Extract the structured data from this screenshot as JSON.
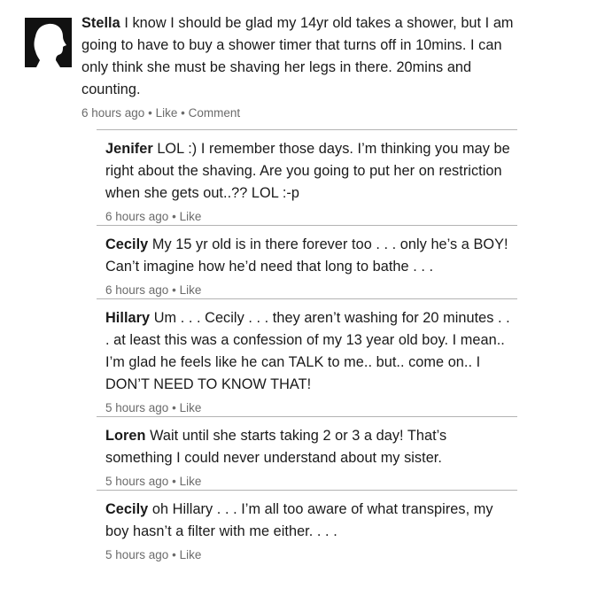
{
  "main": {
    "author": "Stella",
    "text": "I know I should be glad my 14yr old takes a shower, but I am going to have to buy a shower timer that turns off in 10mins. I can only think she must be shaving her legs in there. 20mins and counting.",
    "time": "6 hours ago",
    "like_label": "Like",
    "comment_label": "Comment",
    "separator": "•",
    "avatar_icon": "silhouette-profile-icon"
  },
  "replies": [
    {
      "author": "Jenifer",
      "text": "LOL :) I remember those days. I’m thinking you may be right about the shaving. Are you going to put her on restriction when she gets out..?? LOL :-p",
      "time": "6 hours ago",
      "like_label": "Like"
    },
    {
      "author": "Cecily",
      "text": "My 15 yr old is in there forever too . . . only he’s a BOY! Can’t imagine how he’d need that long to bathe . . .",
      "time": "6 hours ago",
      "like_label": "Like"
    },
    {
      "author": "Hillary",
      "text": "Um . . . Cecily . . . they aren’t washing for 20 minutes . . . at least this was a confession of my 13 year old boy. I mean.. I’m glad he feels like he can TALK to me.. but.. come on.. I DON’T NEED TO KNOW THAT!",
      "time": "5 hours ago",
      "like_label": "Like"
    },
    {
      "author": "Loren",
      "text": "Wait until she starts taking 2 or 3 a day! That’s something I could never understand about my sister.",
      "time": "5 hours ago",
      "like_label": "Like"
    },
    {
      "author": "Cecily",
      "text": "oh Hillary . . . I’m all too aware of what transpires, my boy hasn’t a filter with me either. . . .",
      "time": "5 hours ago",
      "like_label": "Like"
    }
  ]
}
